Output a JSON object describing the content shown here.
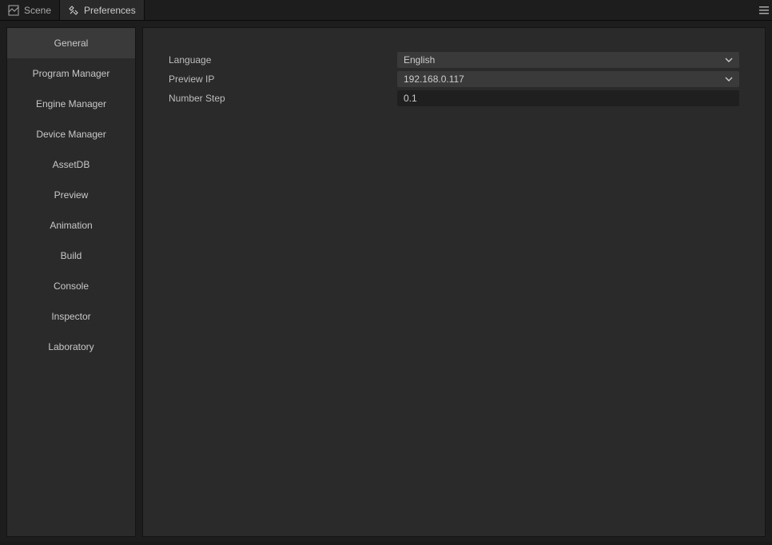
{
  "tabs": {
    "scene": "Scene",
    "preferences": "Preferences"
  },
  "sidebar": {
    "items": [
      {
        "label": "General"
      },
      {
        "label": "Program Manager"
      },
      {
        "label": "Engine Manager"
      },
      {
        "label": "Device Manager"
      },
      {
        "label": "AssetDB"
      },
      {
        "label": "Preview"
      },
      {
        "label": "Animation"
      },
      {
        "label": "Build"
      },
      {
        "label": "Console"
      },
      {
        "label": "Inspector"
      },
      {
        "label": "Laboratory"
      }
    ],
    "active_index": 0
  },
  "form": {
    "language": {
      "label": "Language",
      "value": "English"
    },
    "preview_ip": {
      "label": "Preview IP",
      "value": "192.168.0.117"
    },
    "number_step": {
      "label": "Number Step",
      "value": "0.1"
    }
  }
}
